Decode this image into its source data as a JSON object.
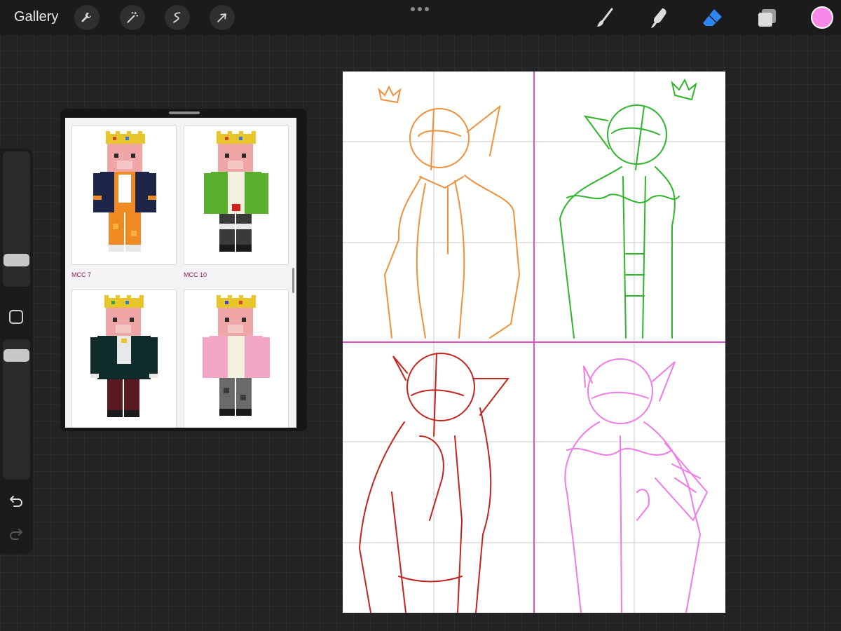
{
  "toolbar": {
    "gallery_label": "Gallery",
    "left_tools": [
      "wrench-icon",
      "magic-wand-icon",
      "selection-icon",
      "transform-arrow-icon"
    ],
    "right_tools": [
      "brush-icon",
      "smudge-icon",
      "eraser-icon",
      "layers-icon"
    ],
    "active_tool": "eraser-icon",
    "current_color": "#f78ae9"
  },
  "reference": {
    "cards": [
      {
        "caption": "MCC 7",
        "outfit": "orange"
      },
      {
        "caption": "MCC 10",
        "outfit": "green"
      },
      {
        "caption": "",
        "outfit": "dark-green"
      },
      {
        "caption": "",
        "outfit": "pink"
      }
    ]
  },
  "canvas": {
    "panel_colors": [
      "#f0903a",
      "#2fb52a",
      "#c3241d",
      "#f07ae6"
    ],
    "divider_color": "#e050c0"
  }
}
